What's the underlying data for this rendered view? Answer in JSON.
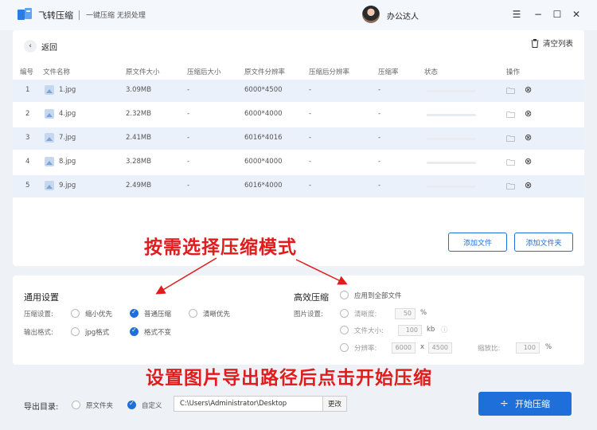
{
  "titlebar": {
    "app_name": "飞转压缩",
    "app_sub": "一键压缩 无损处理",
    "user_name": "办公达人"
  },
  "toolbar": {
    "back_label": "返回",
    "clear_label": "清空列表"
  },
  "table": {
    "headers": [
      "编号",
      "文件名称",
      "原文件大小",
      "压缩后大小",
      "原文件分辨率",
      "压缩后分辨率",
      "压缩率",
      "状态",
      "操作"
    ],
    "rows": [
      {
        "no": "1",
        "name": "1.jpg",
        "size": "3.09MB",
        "csize": "-",
        "res": "6000*4500",
        "cres": "-",
        "rate": "-"
      },
      {
        "no": "2",
        "name": "4.jpg",
        "size": "2.32MB",
        "csize": "-",
        "res": "6000*4000",
        "cres": "-",
        "rate": "-"
      },
      {
        "no": "3",
        "name": "7.jpg",
        "size": "2.41MB",
        "csize": "-",
        "res": "6016*4016",
        "cres": "-",
        "rate": "-"
      },
      {
        "no": "4",
        "name": "8.jpg",
        "size": "3.28MB",
        "csize": "-",
        "res": "6000*4000",
        "cres": "-",
        "rate": "-"
      },
      {
        "no": "5",
        "name": "9.jpg",
        "size": "2.49MB",
        "csize": "-",
        "res": "6016*4000",
        "cres": "-",
        "rate": "-"
      }
    ]
  },
  "buttons": {
    "add_file": "添加文件",
    "add_folder": "添加文件夹",
    "start": "开始压缩"
  },
  "general": {
    "title": "通用设置",
    "compress_label": "压缩设置:",
    "compress_opts": [
      "缩小优先",
      "普通压缩",
      "清晰优先"
    ],
    "output_label": "输出格式:",
    "output_opts": [
      "jpg格式",
      "格式不变"
    ]
  },
  "efficient": {
    "title": "高效压缩",
    "apply_all": "应用到全部文件",
    "image_label": "图片设置:",
    "clarity_label": "清晰度:",
    "clarity_value": "50",
    "clarity_unit": "%",
    "filesize_label": "文件大小:",
    "filesize_value": "100",
    "filesize_unit": "kb",
    "resolution_label": "分辨率:",
    "res_w": "6000",
    "res_x": "x",
    "res_h": "4500",
    "scale_label": "缩放比:",
    "scale_value": "100",
    "scale_unit": "%"
  },
  "export": {
    "label": "导出目录:",
    "opt_original": "原文件夹",
    "opt_custom": "自定义",
    "path": "C:\\Users\\Administrator\\Desktop",
    "change": "更改"
  },
  "annotations": {
    "mode_hint": "按需选择压缩模式",
    "path_hint": "设置图片导出路径后点击开始压缩"
  },
  "colors": {
    "accent": "#1e6fd9",
    "annotation": "#e01c1c",
    "selected_row": "#eaf1fb"
  }
}
